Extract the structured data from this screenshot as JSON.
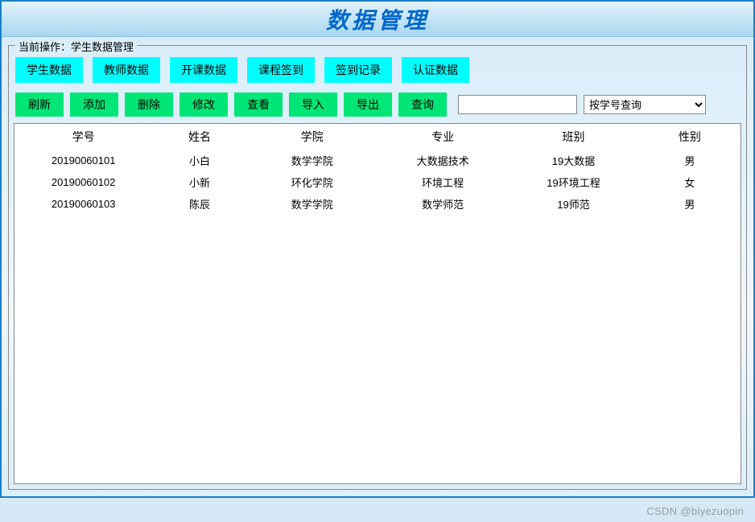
{
  "window": {
    "title": "数据管理"
  },
  "groupbox": {
    "label_prefix": "当前操作：",
    "current_operation": "学生数据管理"
  },
  "tabs": [
    {
      "label": "学生数据"
    },
    {
      "label": "教师数据"
    },
    {
      "label": "开课数据"
    },
    {
      "label": "课程签到"
    },
    {
      "label": "签到记录"
    },
    {
      "label": "认证数据"
    }
  ],
  "actions": [
    {
      "label": "刷新"
    },
    {
      "label": "添加"
    },
    {
      "label": "删除"
    },
    {
      "label": "修改"
    },
    {
      "label": "查看"
    },
    {
      "label": "导入"
    },
    {
      "label": "导出"
    },
    {
      "label": "查询"
    }
  ],
  "search": {
    "input_value": "",
    "select_value": "按学号查询"
  },
  "table": {
    "headers": [
      "学号",
      "姓名",
      "学院",
      "专业",
      "班别",
      "性别"
    ],
    "rows": [
      {
        "id": "20190060101",
        "name": "小白",
        "college": "数学学院",
        "major": "大数据技术",
        "class": "19大数据",
        "gender": "男"
      },
      {
        "id": "20190060102",
        "name": "小新",
        "college": "环化学院",
        "major": "环境工程",
        "class": "19环境工程",
        "gender": "女"
      },
      {
        "id": "20190060103",
        "name": "陈辰",
        "college": "数学学院",
        "major": "数学师范",
        "class": "19师范",
        "gender": "男"
      }
    ]
  },
  "watermark": "CSDN @biyezuopin"
}
